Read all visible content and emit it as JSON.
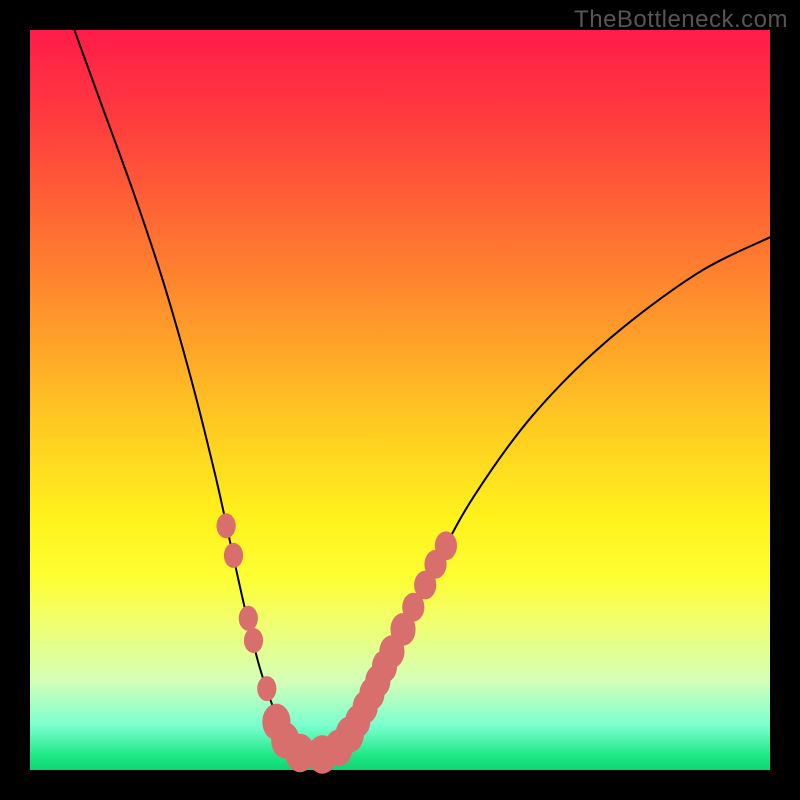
{
  "watermark": "TheBottleneck.com",
  "colors": {
    "frame": "#000000",
    "marker": "#d96f6d",
    "curve": "#000000",
    "gradient_top": "#ff1c49",
    "gradient_mid": "#fff21c",
    "gradient_bottom": "#0fd574"
  },
  "chart_data": {
    "type": "line",
    "title": "",
    "xlabel": "",
    "ylabel": "",
    "xlim": [
      0,
      100
    ],
    "ylim": [
      0,
      100
    ],
    "grid": false,
    "series": [
      {
        "name": "bottleneck-curve",
        "x": [
          6,
          10,
          14,
          18,
          22,
          25,
          27,
          29,
          31,
          33,
          34,
          35,
          36,
          38,
          40,
          42,
          44,
          46,
          50,
          55,
          60,
          68,
          78,
          90,
          100
        ],
        "values": [
          100,
          89,
          78,
          66,
          52,
          40,
          31,
          22,
          14,
          8,
          5,
          3.5,
          2.5,
          2,
          2.2,
          3.2,
          6,
          10,
          18,
          28,
          37,
          48,
          58,
          67,
          72
        ]
      }
    ],
    "markers": [
      {
        "x": 26.5,
        "y": 33,
        "r": 1.3
      },
      {
        "x": 27.5,
        "y": 29,
        "r": 1.3
      },
      {
        "x": 29.5,
        "y": 20.5,
        "r": 1.3
      },
      {
        "x": 30.2,
        "y": 17.5,
        "r": 1.3
      },
      {
        "x": 32.0,
        "y": 11,
        "r": 1.3
      },
      {
        "x": 33.3,
        "y": 6.5,
        "r": 1.9
      },
      {
        "x": 34.5,
        "y": 4,
        "r": 1.9
      },
      {
        "x": 36.5,
        "y": 2.3,
        "r": 2.0
      },
      {
        "x": 39.5,
        "y": 2.1,
        "r": 2.0
      },
      {
        "x": 41.7,
        "y": 3.0,
        "r": 1.9
      },
      {
        "x": 43.2,
        "y": 4.8,
        "r": 1.9
      },
      {
        "x": 44.3,
        "y": 6.6,
        "r": 1.7
      },
      {
        "x": 45.3,
        "y": 8.5,
        "r": 1.7
      },
      {
        "x": 46.2,
        "y": 10.3,
        "r": 1.7
      },
      {
        "x": 47.0,
        "y": 12.0,
        "r": 1.7
      },
      {
        "x": 47.9,
        "y": 14.0,
        "r": 1.7
      },
      {
        "x": 48.9,
        "y": 16.0,
        "r": 1.7
      },
      {
        "x": 50.4,
        "y": 19,
        "r": 1.7
      },
      {
        "x": 51.8,
        "y": 22,
        "r": 1.5
      },
      {
        "x": 53.4,
        "y": 25,
        "r": 1.5
      },
      {
        "x": 54.8,
        "y": 27.8,
        "r": 1.5
      },
      {
        "x": 56.2,
        "y": 30.3,
        "r": 1.5
      }
    ]
  }
}
